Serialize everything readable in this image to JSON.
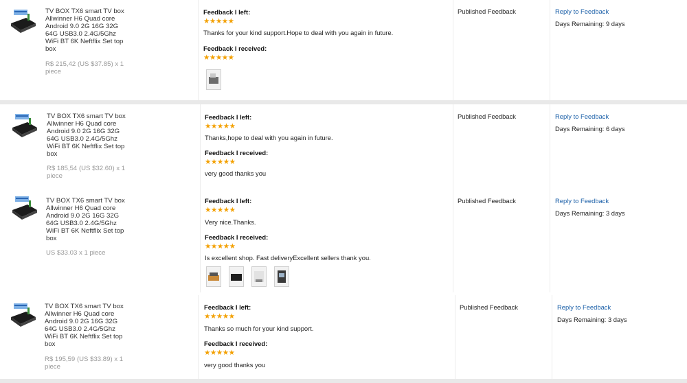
{
  "rows": [
    {
      "title": "TV BOX TX6 smart TV box Allwinner H6 Quad core Android 9.0 2G 16G 32G 64G USB3.0 2.4G/5Ghz WiFi BT 6K Neftflix Set top box",
      "price": "R$ 215,42 (US $37.85) x 1 piece",
      "left_label": "Feedback I left:",
      "left_stars": "★★★★★",
      "left_text": "Thanks for your kind support.Hope to deal with you again in future.",
      "received_label": "Feedback I received:",
      "received_stars": "★★★★★",
      "received_text": "",
      "status": "Published Feedback",
      "reply": "Reply to Feedback",
      "days": "Days Remaining: 9 days"
    },
    {
      "title": "TV BOX TX6 smart TV box Allwinner H6 Quad core Android 9.0 2G 16G 32G 64G USB3.0 2.4G/5Ghz WiFi BT 6K Neftflix Set top box",
      "price": "R$ 185,54 (US $32.60) x 1 piece",
      "left_label": "Feedback I left:",
      "left_stars": "★★★★★",
      "left_text": "Thanks,hope to deal with you again in future.",
      "received_label": "Feedback I received:",
      "received_stars": "★★★★★",
      "received_text": "very good thanks you",
      "status": "Published Feedback",
      "reply": "Reply to Feedback",
      "days": "Days Remaining: 6 days"
    },
    {
      "title": "TV BOX TX6 smart TV box Allwinner H6 Quad core Android 9.0 2G 16G 32G 64G USB3.0 2.4G/5Ghz WiFi BT 6K Neftflix Set top box",
      "price": "US $33.03 x 1 piece",
      "left_label": "Feedback I left:",
      "left_stars": "★★★★★",
      "left_text": "Very nice.Thanks.",
      "received_label": "Feedback I received:",
      "received_stars": "★★★★★",
      "received_text": "Is excellent shop. Fast deliveryExcellent sellers thank you.",
      "status": "Published Feedback",
      "reply": "Reply to Feedback",
      "days": "Days Remaining: 3 days"
    },
    {
      "title": "TV BOX TX6 smart TV box Allwinner H6 Quad core Android 9.0 2G 16G 32G 64G USB3.0 2.4G/5Ghz WiFi BT 6K Neftflix Set top box",
      "price": "R$ 195,59 (US $33.89) x 1 piece",
      "left_label": "Feedback I left:",
      "left_stars": "★★★★★",
      "left_text": "Thanks so much for your kind support.",
      "received_label": "Feedback I received:",
      "received_stars": "★★★★★",
      "received_text": "very good thanks you",
      "status": "Published Feedback",
      "reply": "Reply to Feedback",
      "days": "Days Remaining: 3 days"
    }
  ],
  "colors": {
    "star": "#f3a000",
    "link": "#1a5fa8",
    "separator": "#e9e9e9",
    "price": "#9a9a9a"
  }
}
